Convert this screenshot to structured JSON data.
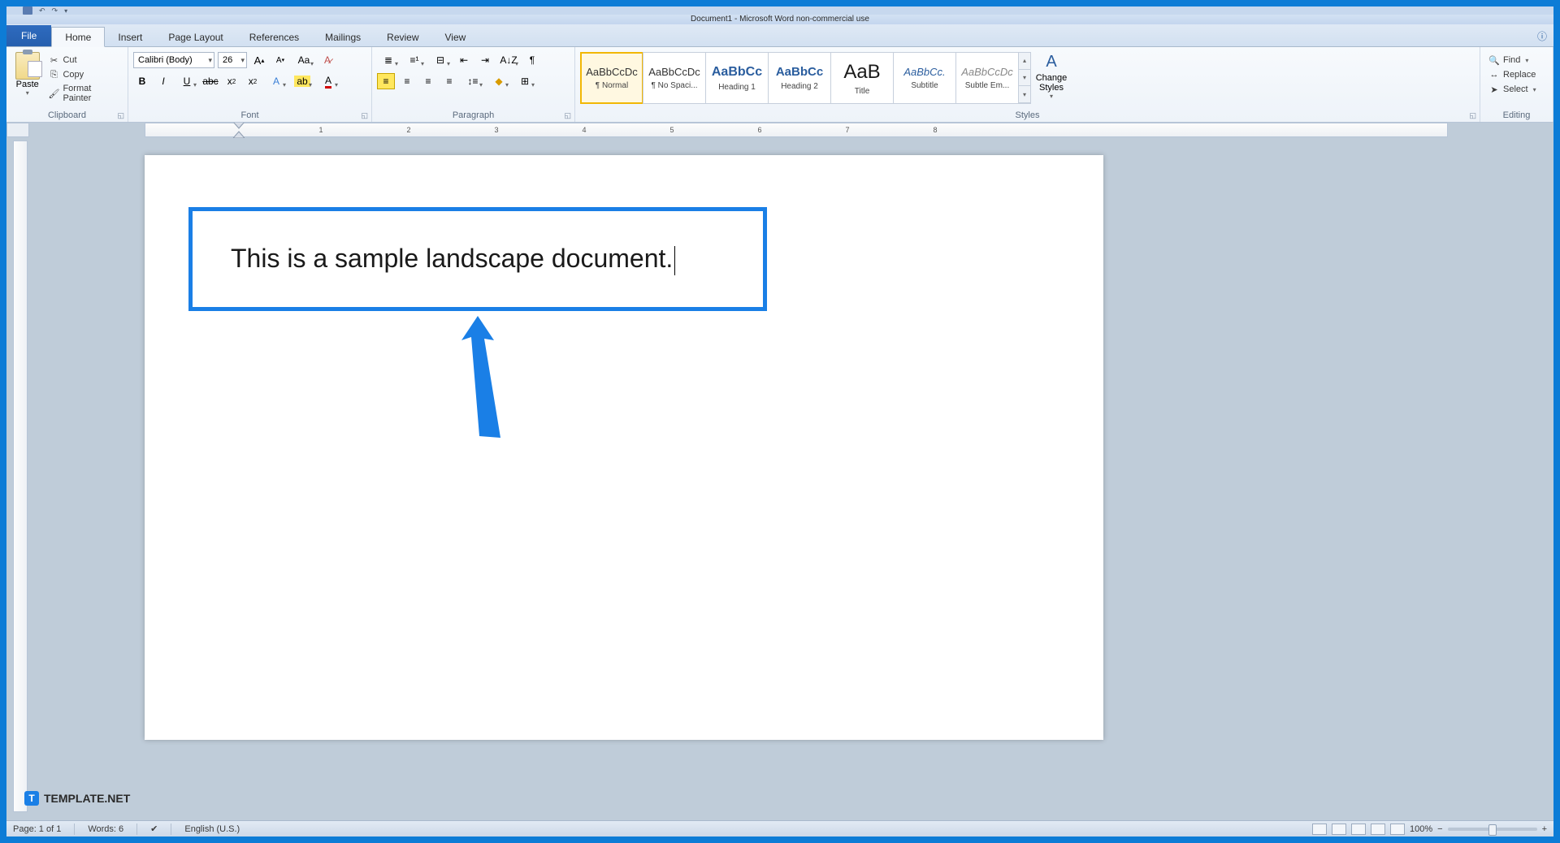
{
  "title": "Document1 - Microsoft Word non-commercial use",
  "tabs": {
    "file": "File",
    "home": "Home",
    "insert": "Insert",
    "page_layout": "Page Layout",
    "references": "References",
    "mailings": "Mailings",
    "review": "Review",
    "view": "View"
  },
  "clipboard": {
    "paste": "Paste",
    "cut": "Cut",
    "copy": "Copy",
    "format_painter": "Format Painter",
    "group": "Clipboard"
  },
  "font": {
    "name": "Calibri (Body)",
    "size": "26",
    "group": "Font"
  },
  "paragraph": {
    "group": "Paragraph"
  },
  "styles": {
    "group": "Styles",
    "items": [
      {
        "preview": "AaBbCcDc",
        "label": "¶ Normal",
        "active": true,
        "color": "#333",
        "size": "13px"
      },
      {
        "preview": "AaBbCcDc",
        "label": "¶ No Spaci...",
        "color": "#333",
        "size": "13px"
      },
      {
        "preview": "AaBbCc",
        "label": "Heading 1",
        "color": "#2a5d9e",
        "size": "16px",
        "weight": "bold"
      },
      {
        "preview": "AaBbCc",
        "label": "Heading 2",
        "color": "#2a5d9e",
        "size": "15px",
        "weight": "bold"
      },
      {
        "preview": "AaB",
        "label": "Title",
        "color": "#1a1a1a",
        "size": "24px"
      },
      {
        "preview": "AaBbCc.",
        "label": "Subtitle",
        "color": "#2a5d9e",
        "size": "13px",
        "italic": true
      },
      {
        "preview": "AaBbCcDc",
        "label": "Subtle Em...",
        "color": "#888",
        "size": "13px",
        "italic": true
      }
    ],
    "change": "Change Styles"
  },
  "editing": {
    "group": "Editing",
    "find": "Find",
    "replace": "Replace",
    "select": "Select"
  },
  "document": {
    "text": "This is a sample landscape document."
  },
  "status": {
    "page": "Page: 1 of 1",
    "words": "Words: 6",
    "lang": "English (U.S.)",
    "zoom": "100%"
  },
  "watermark": "TEMPLATE.NET",
  "ruler_numbers": [
    "1",
    "2",
    "3",
    "4",
    "5",
    "6",
    "7",
    "8"
  ]
}
